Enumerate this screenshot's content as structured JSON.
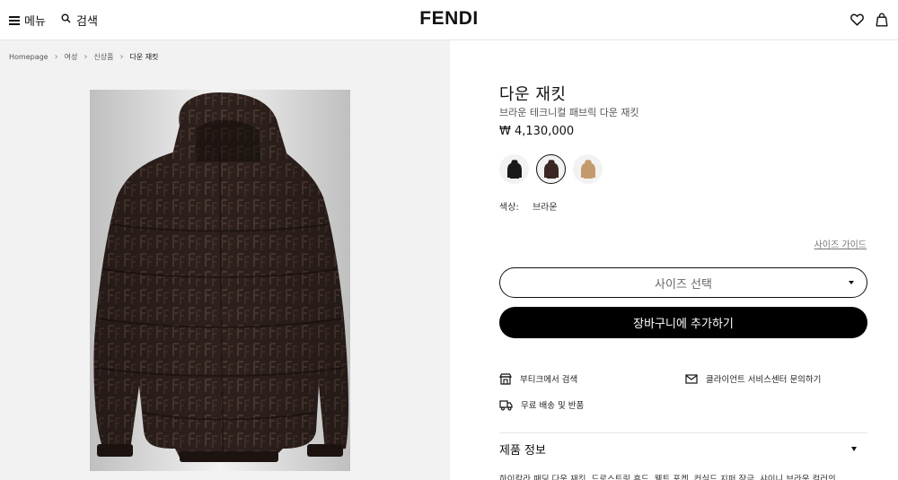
{
  "header": {
    "menu_label": "메뉴",
    "search_label": "검색",
    "logo": "FENDI"
  },
  "breadcrumb": [
    "Homepage",
    "여성",
    "신상품",
    "다운 재킷"
  ],
  "product": {
    "title": "다운 재킷",
    "subtitle": "브라운 테크니컬 패브릭 다운 재킷",
    "price": "₩ 4,130,000",
    "color_label": "색상:",
    "color_value": "브라운",
    "swatches": [
      {
        "color": "#1a1a1a",
        "selected": false
      },
      {
        "color": "#3a2622",
        "selected": true
      },
      {
        "color": "#c49a6c",
        "selected": false
      }
    ]
  },
  "actions": {
    "size_guide": "사이즈 가이드",
    "size_select": "사이즈 선택",
    "add_to_cart": "장바구니에 추가하기"
  },
  "services": {
    "boutique": "부티크에서 검색",
    "client_service": "클라이언트 서비스센터 문의하기",
    "shipping": "무료 배송 및 반품"
  },
  "details": {
    "heading": "제품 정보",
    "description": "하이칼라 패딩 다운 재킷. 드로스트링 후드, 웰트 포켓, 컨실드 지퍼 잠금. 샤이니 브라운 컬러의"
  }
}
